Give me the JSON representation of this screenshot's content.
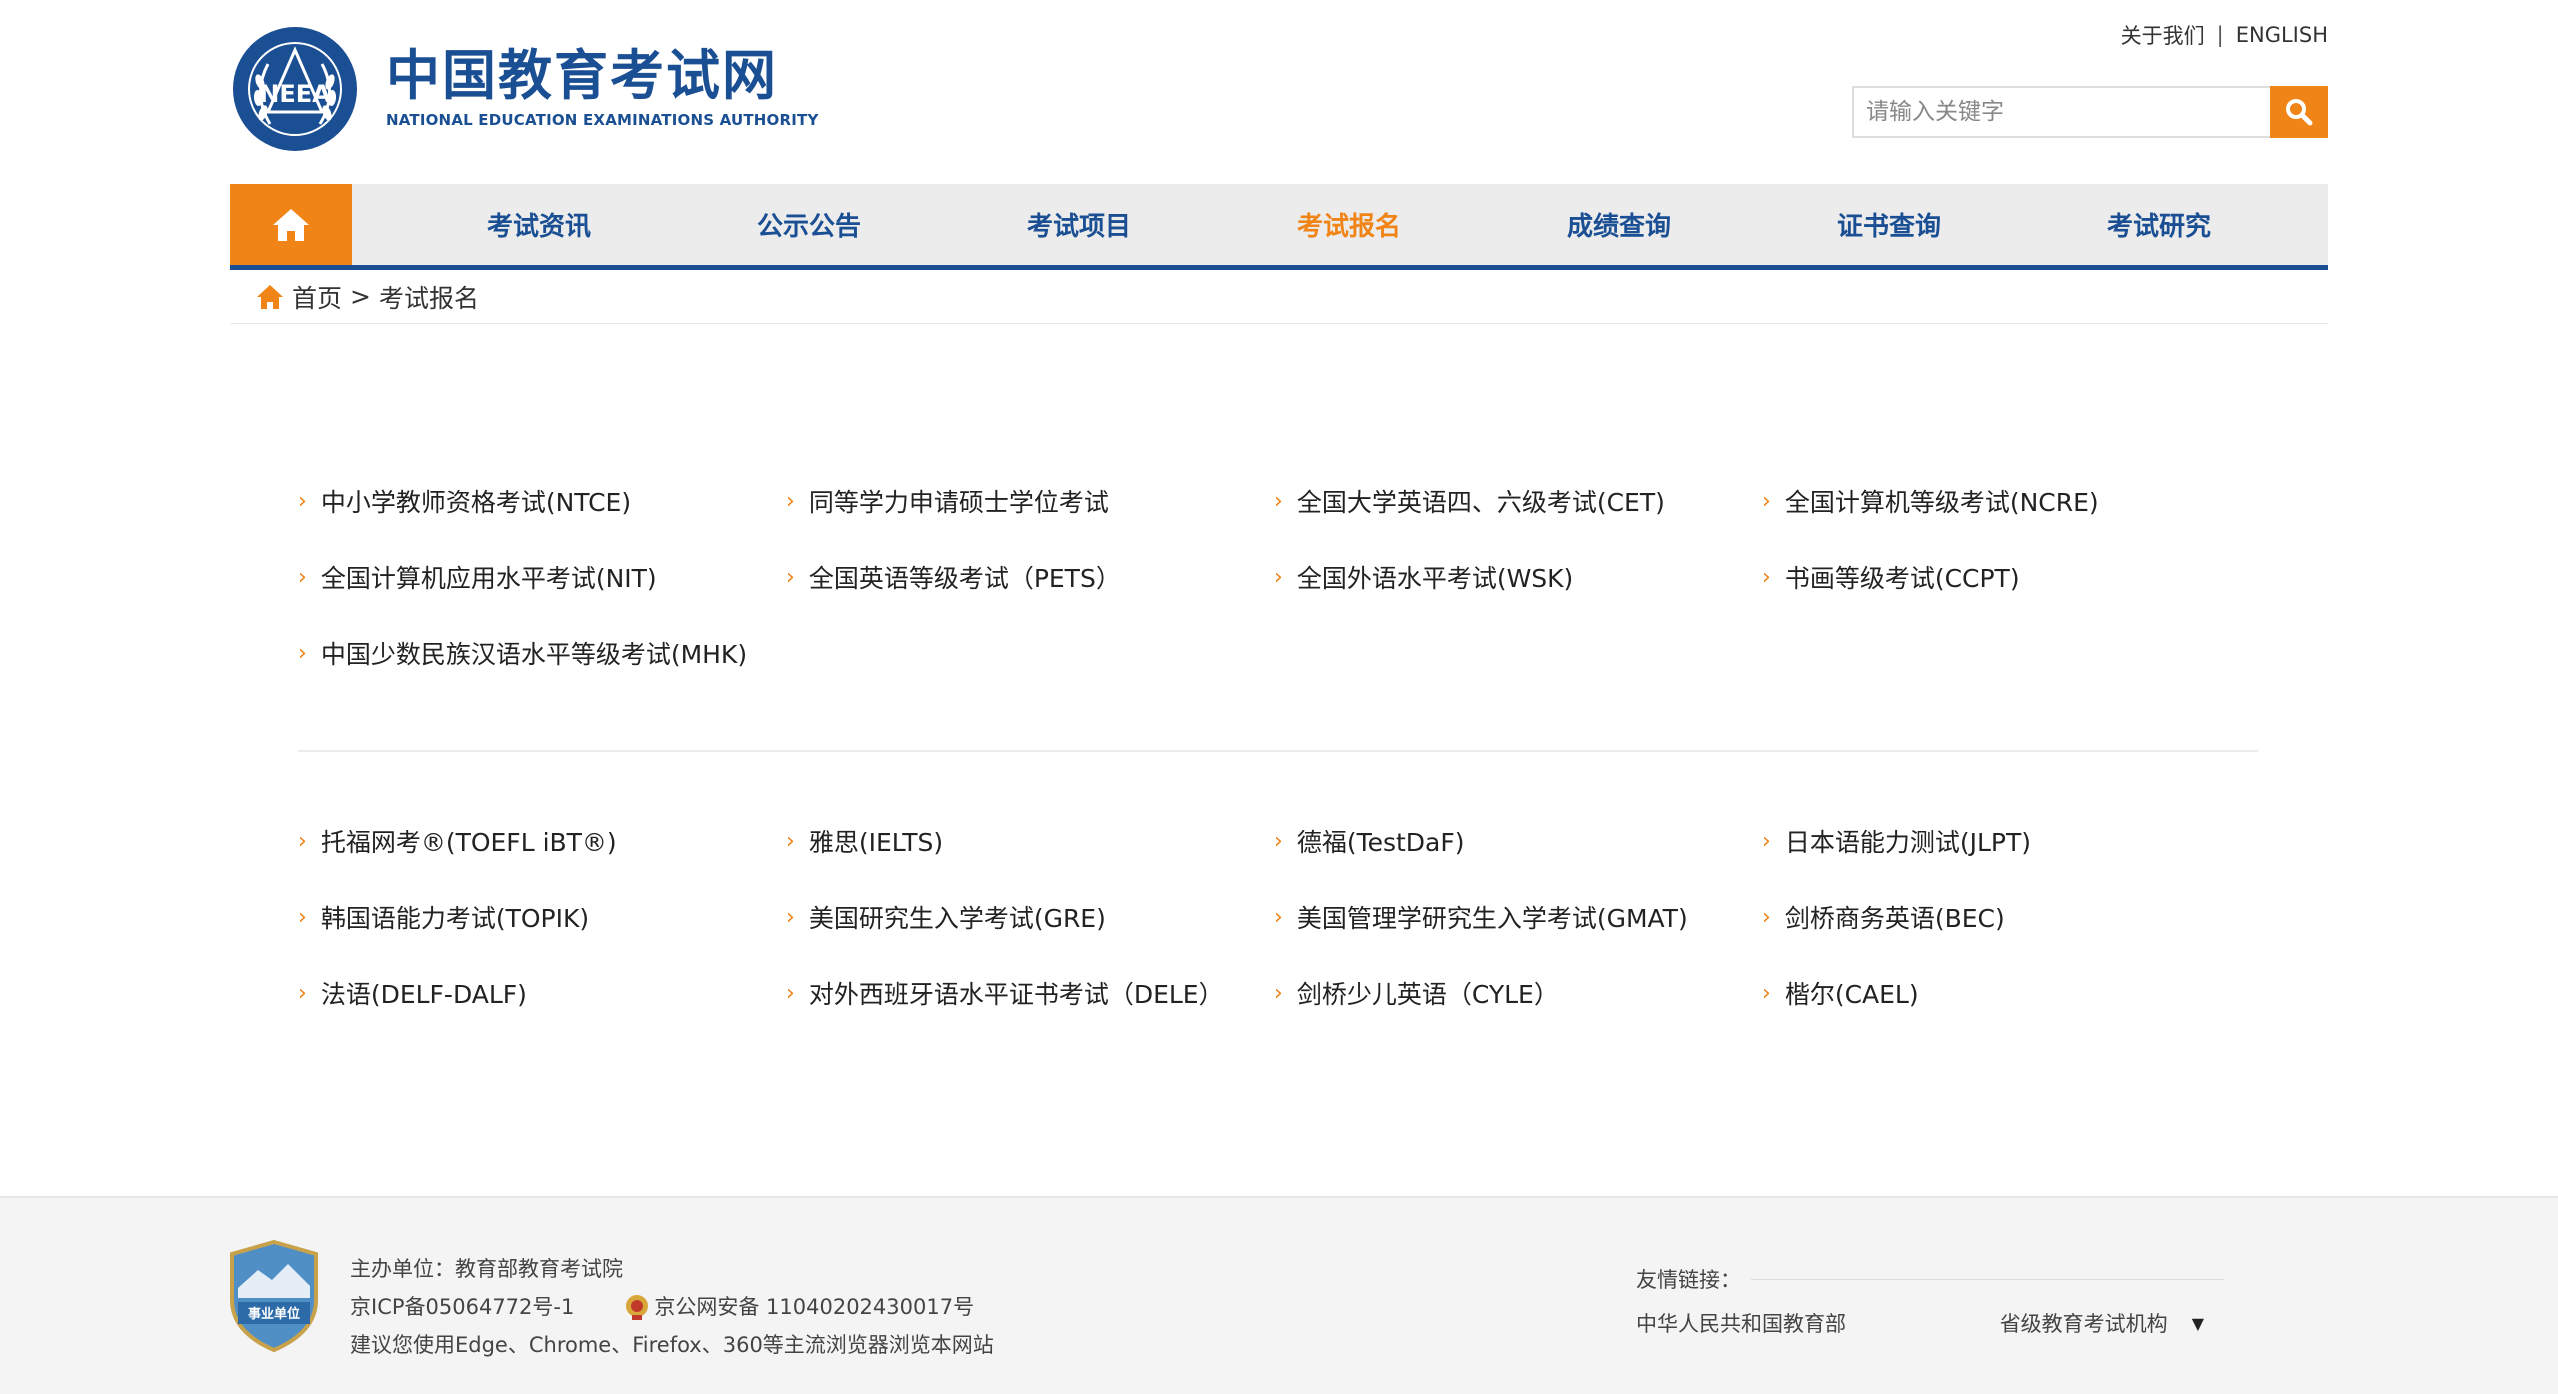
{
  "header": {
    "top_links": {
      "about": "关于我们",
      "separator": "|",
      "english": "ENGLISH"
    },
    "logo": {
      "emblem_text": "NEEA",
      "title_cn": "中国教育考试网",
      "title_en": "NATIONAL EDUCATION EXAMINATIONS AUTHORITY"
    },
    "search": {
      "placeholder": "请输入关键字",
      "value": "",
      "button_icon": "search-icon"
    },
    "colors": {
      "brand_blue": "#1b4f94",
      "accent_orange": "#f08417"
    }
  },
  "nav": {
    "home_icon": "home-icon",
    "items": [
      {
        "label": "考试资讯",
        "active": false
      },
      {
        "label": "公示公告",
        "active": false
      },
      {
        "label": "考试项目",
        "active": false
      },
      {
        "label": "考试报名",
        "active": true
      },
      {
        "label": "成绩查询",
        "active": false
      },
      {
        "label": "证书查询",
        "active": false
      },
      {
        "label": "考试研究",
        "active": false
      }
    ]
  },
  "breadcrumb": {
    "home": "首页",
    "separator": ">",
    "current": "考试报名"
  },
  "domestic_exams": [
    "中小学教师资格考试(NTCE)",
    "同等学力申请硕士学位考试",
    "全国大学英语四、六级考试(CET)",
    "全国计算机等级考试(NCRE)",
    "全国计算机应用水平考试(NIT)",
    "全国英语等级考试（PETS）",
    "全国外语水平考试(WSK)",
    "书画等级考试(CCPT)",
    "中国少数民族汉语水平等级考试(MHK)"
  ],
  "international_exams": [
    "托福网考®(TOEFL iBT®)",
    "雅思(IELTS)",
    "德福(TestDaF)",
    "日本语能力测试(JLPT)",
    "韩国语能力考试(TOPIK)",
    "美国研究生入学考试(GRE)",
    "美国管理学研究生入学考试(GMAT)",
    "剑桥商务英语(BEC)",
    "法语(DELF-DALF)",
    "对外西班牙语水平证书考试（DELE）",
    "剑桥少儿英语（CYLE）",
    "楷尔(CAEL)"
  ],
  "footer": {
    "badge_text": "事业单位",
    "sponsor": "主办单位：教育部教育考试院",
    "icp": "京ICP备05064772号-1",
    "police": "京公网安备 11040202430017号",
    "browser_note": "建议您使用Edge、Chrome、Firefox、360等主流浏览器浏览本网站",
    "links_title": "友情链接：",
    "link_moe": "中华人民共和国教育部",
    "link_select": "省级教育考试机构",
    "select_arrow": "▼"
  }
}
